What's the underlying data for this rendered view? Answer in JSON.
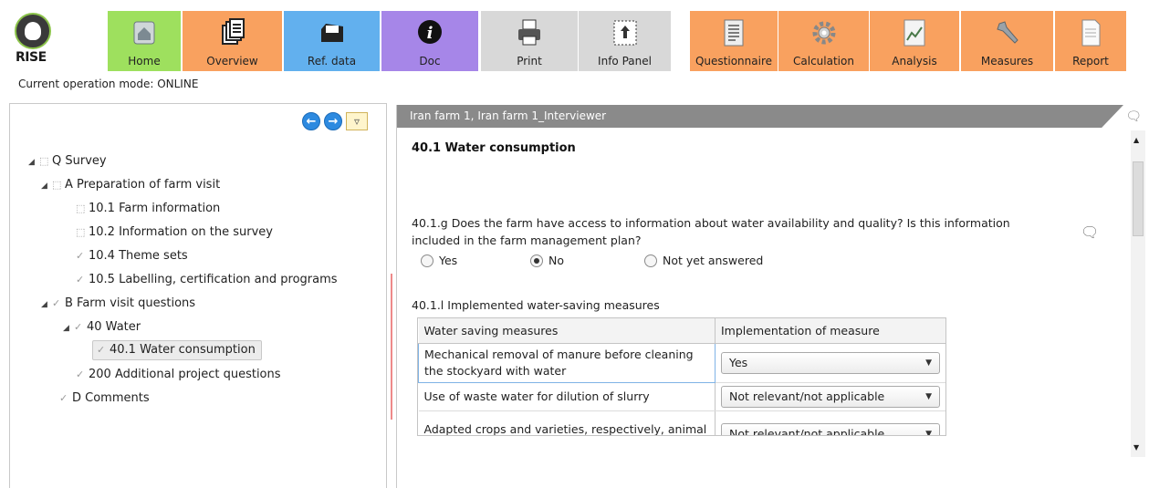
{
  "app": {
    "logo_text": "RISE",
    "mode_text": "Current operation mode: ONLINE"
  },
  "toolbar": [
    {
      "label": "Home",
      "icon": "home-icon",
      "color": "#9ee05e"
    },
    {
      "label": "Overview",
      "icon": "documents-icon",
      "color": "#f9a15f"
    },
    {
      "label": "Ref. data",
      "icon": "folder-icon",
      "color": "#62b0ee"
    },
    {
      "label": "Doc",
      "icon": "info-icon",
      "color": "#a686e8"
    },
    {
      "label": "Print",
      "icon": "printer-icon",
      "color": "#d8d8d8"
    },
    {
      "label": "Info Panel",
      "icon": "info-panel-icon",
      "color": "#d8d8d8"
    },
    {
      "label": "Questionnaire",
      "icon": "questionnaire-icon",
      "color": "#f9a15f"
    },
    {
      "label": "Calculation",
      "icon": "gear-icon",
      "color": "#f9a15f"
    },
    {
      "label": "Analysis",
      "icon": "chart-icon",
      "color": "#f9a15f"
    },
    {
      "label": "Measures",
      "icon": "wrench-icon",
      "color": "#f9a15f"
    },
    {
      "label": "Report",
      "icon": "report-icon",
      "color": "#f9a15f"
    }
  ],
  "tree": [
    {
      "label": "Q Survey",
      "status": "open",
      "expanded": true
    },
    {
      "label": "A Preparation of farm visit",
      "status": "open",
      "expanded": true
    },
    {
      "label": "10.1 Farm information",
      "status": "open"
    },
    {
      "label": "10.2 Information on the survey",
      "status": "open"
    },
    {
      "label": "10.4 Theme sets",
      "status": "done"
    },
    {
      "label": "10.5 Labelling, certification and programs",
      "status": "done"
    },
    {
      "label": "B Farm visit questions",
      "status": "done",
      "expanded": true
    },
    {
      "label": "40 Water",
      "status": "done",
      "expanded": true
    },
    {
      "label": "40.1 Water consumption",
      "status": "done",
      "selected": true
    },
    {
      "label": "200 Additional project questions",
      "status": "done"
    },
    {
      "label": "D Comments",
      "status": "done"
    }
  ],
  "right": {
    "header": "Iran farm 1, Iran farm 1_Interviewer",
    "section_title": "40.1  Water consumption",
    "question": "40.1.g Does the farm have access to information about water availability and quality? Is this information included in the farm management plan?",
    "options": [
      "Yes",
      "No",
      "Not yet answered"
    ],
    "selected_option": "No",
    "table_title": "40.1.l Implemented water-saving measures",
    "table": {
      "headers": [
        "Water saving measures",
        "Implementation of measure"
      ],
      "rows": [
        {
          "measure": "Mechanical removal of manure before cleaning the stockyard with water",
          "value": "Yes"
        },
        {
          "measure": "Use of waste water for dilution of slurry",
          "value": "Not relevant/not applicable"
        },
        {
          "measure": "Adapted crops and varieties, respectively, animal",
          "value": "Not relevant/not applicable"
        }
      ]
    }
  }
}
